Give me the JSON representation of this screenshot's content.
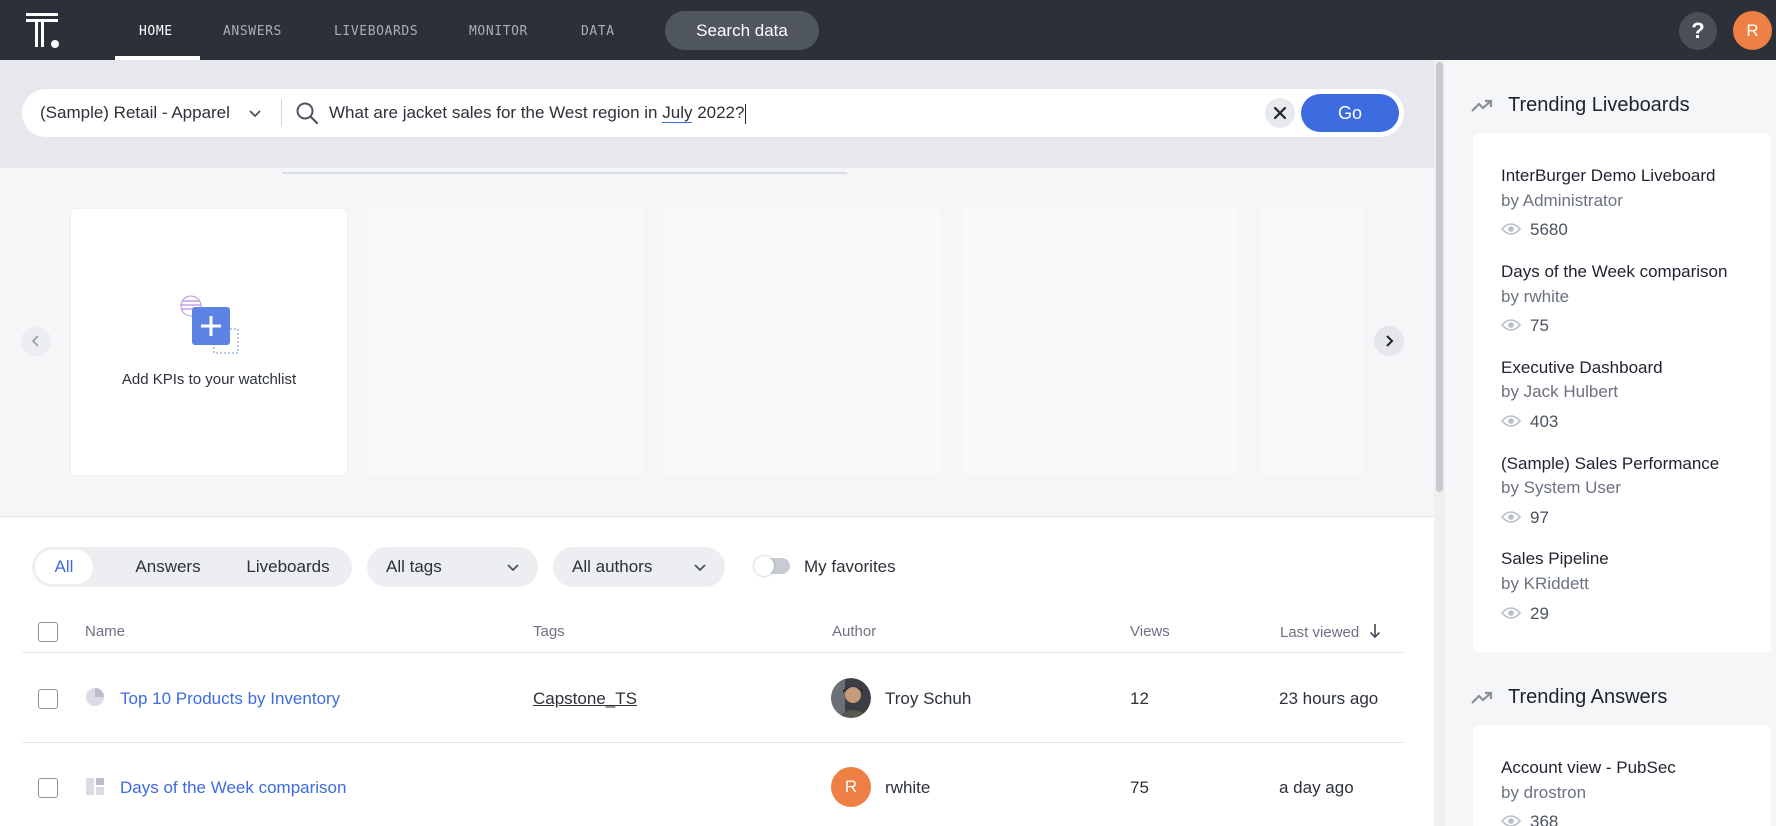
{
  "nav": {
    "items": [
      "HOME",
      "ANSWERS",
      "LIVEBOARDS",
      "MONITOR",
      "DATA"
    ],
    "search_data_label": "Search data",
    "help_label": "?",
    "user_initial": "R"
  },
  "search": {
    "source": "(Sample) Retail - Apparel",
    "query_before": "What are jacket sales for the West region in ",
    "query_underlined": "July",
    "query_after": " 2022?",
    "go_label": "Go"
  },
  "kpi": {
    "add_label": "Add KPIs to your watchlist"
  },
  "filters": {
    "segments": [
      "All",
      "Answers",
      "Liveboards"
    ],
    "tags_label": "All tags",
    "authors_label": "All authors",
    "favorites_label": "My favorites"
  },
  "table": {
    "headers": {
      "name": "Name",
      "tags": "Tags",
      "author": "Author",
      "views": "Views",
      "last_viewed": "Last viewed"
    },
    "rows": [
      {
        "name": "Top 10 Products by Inventory",
        "type_icon": "pie-chart-icon",
        "tag": "Capstone_TS",
        "author": "Troy Schuh",
        "author_avatar": "photo",
        "views": "12",
        "last_viewed": "23 hours ago"
      },
      {
        "name": "Days of the Week comparison",
        "type_icon": "liveboard-icon",
        "tag": "",
        "author": "rwhite",
        "author_initial": "R",
        "views": "75",
        "last_viewed": "a day ago"
      }
    ]
  },
  "trending_liveboards": {
    "title": "Trending Liveboards",
    "items": [
      {
        "title": "InterBurger Demo Liveboard",
        "by": "by Administrator",
        "views": "5680"
      },
      {
        "title": "Days of the Week comparison",
        "by": "by rwhite",
        "views": "75"
      },
      {
        "title": "Executive Dashboard",
        "by": "by Jack Hulbert",
        "views": "403"
      },
      {
        "title": "(Sample) Sales Performance",
        "by": "by System User",
        "views": "97"
      },
      {
        "title": "Sales Pipeline",
        "by": "by KRiddett",
        "views": "29"
      }
    ]
  },
  "trending_answers": {
    "title": "Trending Answers",
    "items": [
      {
        "title": "Account view - PubSec",
        "by": "by drostron",
        "views": "368"
      }
    ]
  },
  "colors": {
    "accent": "#3d6be0",
    "topbar": "#2b3039",
    "avatar": "#ee7f45"
  }
}
